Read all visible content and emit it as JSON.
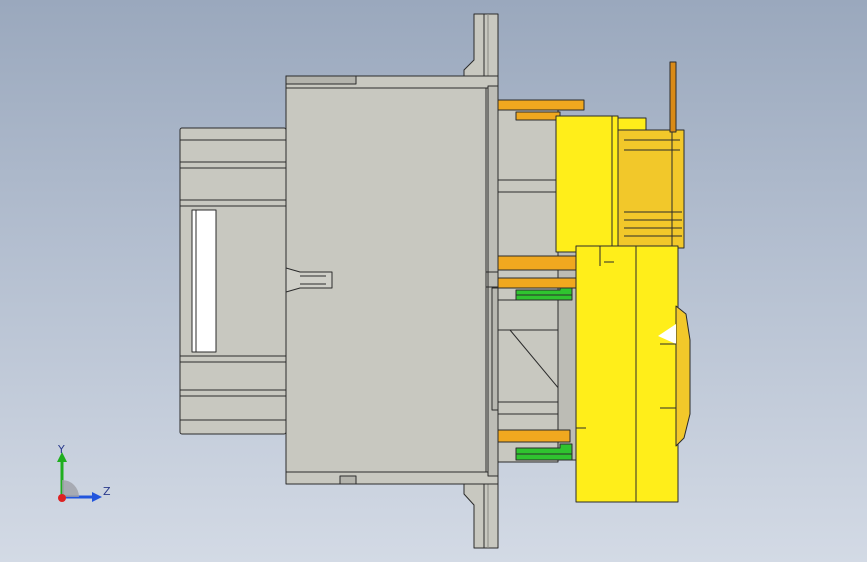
{
  "viewport": {
    "background_top": "#9aa8bd",
    "background_bottom": "#d3dae5"
  },
  "model": {
    "colors": {
      "housing": "#c8c8c0",
      "housing_dark": "#b3b3ac",
      "outline": "#2b2b2b",
      "yellow": "#ffee1a",
      "yellow_shade": "#f2c82a",
      "orange": "#f0a81f",
      "green": "#2fc42f",
      "white": "#ffffff"
    }
  },
  "triad": {
    "y_label": "Y",
    "z_label": "Z",
    "y_color": "#1fae1f",
    "z_color": "#2255dd",
    "x_color": "#dd2222"
  }
}
